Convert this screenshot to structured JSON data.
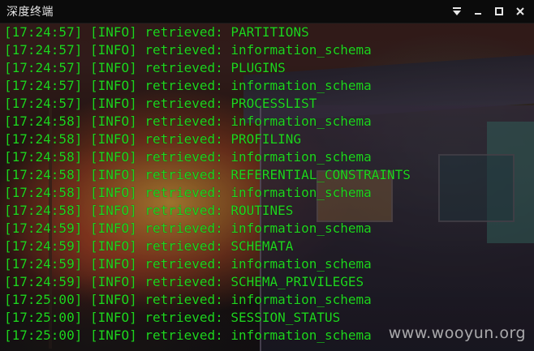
{
  "window": {
    "title": "深度终端"
  },
  "log_lines": [
    {
      "time": "[17:24:57]",
      "level": "[INFO]",
      "msg": "retrieved:",
      "value": "PARTITIONS"
    },
    {
      "time": "[17:24:57]",
      "level": "[INFO]",
      "msg": "retrieved:",
      "value": "information_schema"
    },
    {
      "time": "[17:24:57]",
      "level": "[INFO]",
      "msg": "retrieved:",
      "value": "PLUGINS"
    },
    {
      "time": "[17:24:57]",
      "level": "[INFO]",
      "msg": "retrieved:",
      "value": "information_schema"
    },
    {
      "time": "[17:24:57]",
      "level": "[INFO]",
      "msg": "retrieved:",
      "value": "PROCESSLIST"
    },
    {
      "time": "[17:24:58]",
      "level": "[INFO]",
      "msg": "retrieved:",
      "value": "information_schema"
    },
    {
      "time": "[17:24:58]",
      "level": "[INFO]",
      "msg": "retrieved:",
      "value": "PROFILING"
    },
    {
      "time": "[17:24:58]",
      "level": "[INFO]",
      "msg": "retrieved:",
      "value": "information_schema"
    },
    {
      "time": "[17:24:58]",
      "level": "[INFO]",
      "msg": "retrieved:",
      "value": "REFERENTIAL_CONSTRAINTS"
    },
    {
      "time": "[17:24:58]",
      "level": "[INFO]",
      "msg": "retrieved:",
      "value": "information_schema"
    },
    {
      "time": "[17:24:58]",
      "level": "[INFO]",
      "msg": "retrieved:",
      "value": "ROUTINES"
    },
    {
      "time": "[17:24:59]",
      "level": "[INFO]",
      "msg": "retrieved:",
      "value": "information_schema"
    },
    {
      "time": "[17:24:59]",
      "level": "[INFO]",
      "msg": "retrieved:",
      "value": "SCHEMATA"
    },
    {
      "time": "[17:24:59]",
      "level": "[INFO]",
      "msg": "retrieved:",
      "value": "information_schema"
    },
    {
      "time": "[17:24:59]",
      "level": "[INFO]",
      "msg": "retrieved:",
      "value": "SCHEMA_PRIVILEGES"
    },
    {
      "time": "[17:25:00]",
      "level": "[INFO]",
      "msg": "retrieved:",
      "value": "information_schema"
    },
    {
      "time": "[17:25:00]",
      "level": "[INFO]",
      "msg": "retrieved:",
      "value": "SESSION_STATUS"
    },
    {
      "time": "[17:25:00]",
      "level": "[INFO]",
      "msg": "retrieved:",
      "value": "information_schema"
    }
  ],
  "watermark": "www.wooyun.org",
  "icons": {
    "menu": "menu-dropdown-icon",
    "minimize": "minimize-icon",
    "maximize": "maximize-icon",
    "close": "close-icon"
  },
  "colors": {
    "terminal_text": "#1fd51f",
    "titlebar_bg": "#0b0b0b",
    "title_text": "#e6e6e6"
  }
}
